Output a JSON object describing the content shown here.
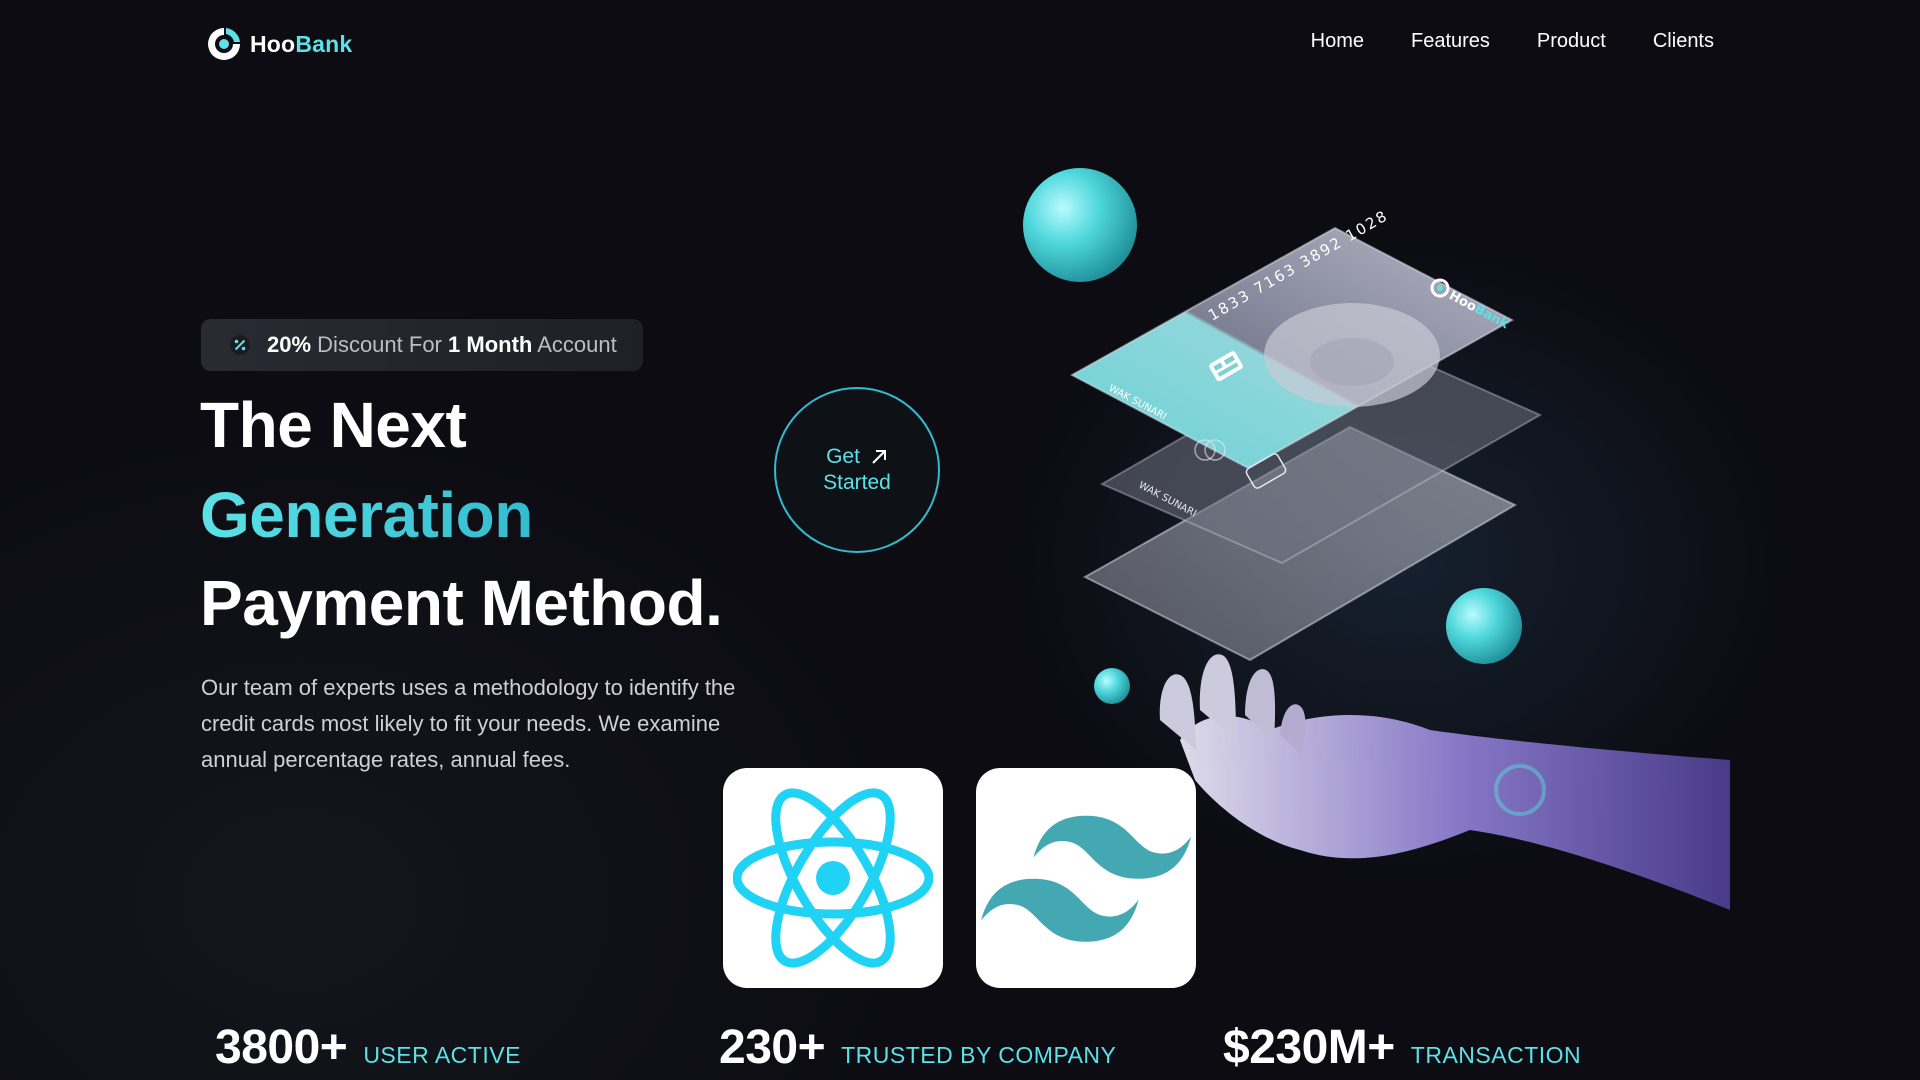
{
  "brand": {
    "name_part1": "Hoo",
    "name_part2": "Bank",
    "accent": "#5ce1e6",
    "accent_dark": "#33bbcf"
  },
  "nav": {
    "items": [
      {
        "label": "Home"
      },
      {
        "label": "Features"
      },
      {
        "label": "Product"
      },
      {
        "label": "Clients"
      }
    ]
  },
  "hero": {
    "promo": {
      "icon": "discount-icon",
      "value": "20%",
      "text1": "Discount For",
      "value2": "1 Month",
      "text2": "Account"
    },
    "headline": {
      "line1": "The Next",
      "line2": "Generation",
      "line3": "Payment Method."
    },
    "description": "Our team of experts uses a methodology to identify the credit cards most likely to fit your needs. We examine annual percentage rates, annual fees.",
    "cta": {
      "line1": "Get",
      "line2": "Started",
      "icon": "arrow-up-right-icon"
    },
    "card": {
      "number": "1833 7163 3892 1028",
      "holder": "WAK SUNARI",
      "brand_part1": "Hoo",
      "brand_part2": "Bank"
    }
  },
  "tech_logos": [
    {
      "icon": "react-icon"
    },
    {
      "icon": "tailwind-icon"
    }
  ],
  "stats": [
    {
      "value": "3800+",
      "label": "USER ACTIVE"
    },
    {
      "value": "230+",
      "label": "TRUSTED BY COMPANY"
    },
    {
      "value": "$230M+",
      "label": "TRANSACTION"
    }
  ]
}
